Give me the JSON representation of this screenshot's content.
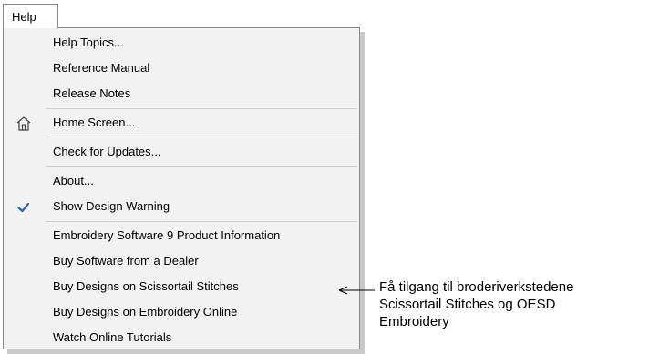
{
  "menubar": {
    "help_label": "Help"
  },
  "menu": {
    "items": [
      {
        "label": "Help Topics..."
      },
      {
        "label": "Reference Manual"
      },
      {
        "label": "Release Notes"
      },
      {
        "label": "Home Screen...",
        "icon": "home-icon"
      },
      {
        "label": "Check for Updates..."
      },
      {
        "label": "About..."
      },
      {
        "label": "Show Design Warning",
        "checked": true,
        "icon": "checkmark-icon"
      },
      {
        "label": "Embroidery Software 9 Product Information"
      },
      {
        "label": "Buy Software from a Dealer"
      },
      {
        "label": "Buy Designs on Scissortail Stitches"
      },
      {
        "label": "Buy Designs on Embroidery Online"
      },
      {
        "label": "Watch Online Tutorials"
      }
    ]
  },
  "callout": {
    "text": "Få tilgang til broderiverkstedene\nScissortail Stitches og OESD\nEmbroidery"
  },
  "colors": {
    "menu_background": "#f2f2f2",
    "menu_border": "#8a8a8a",
    "checkmark": "#2a64b4"
  }
}
